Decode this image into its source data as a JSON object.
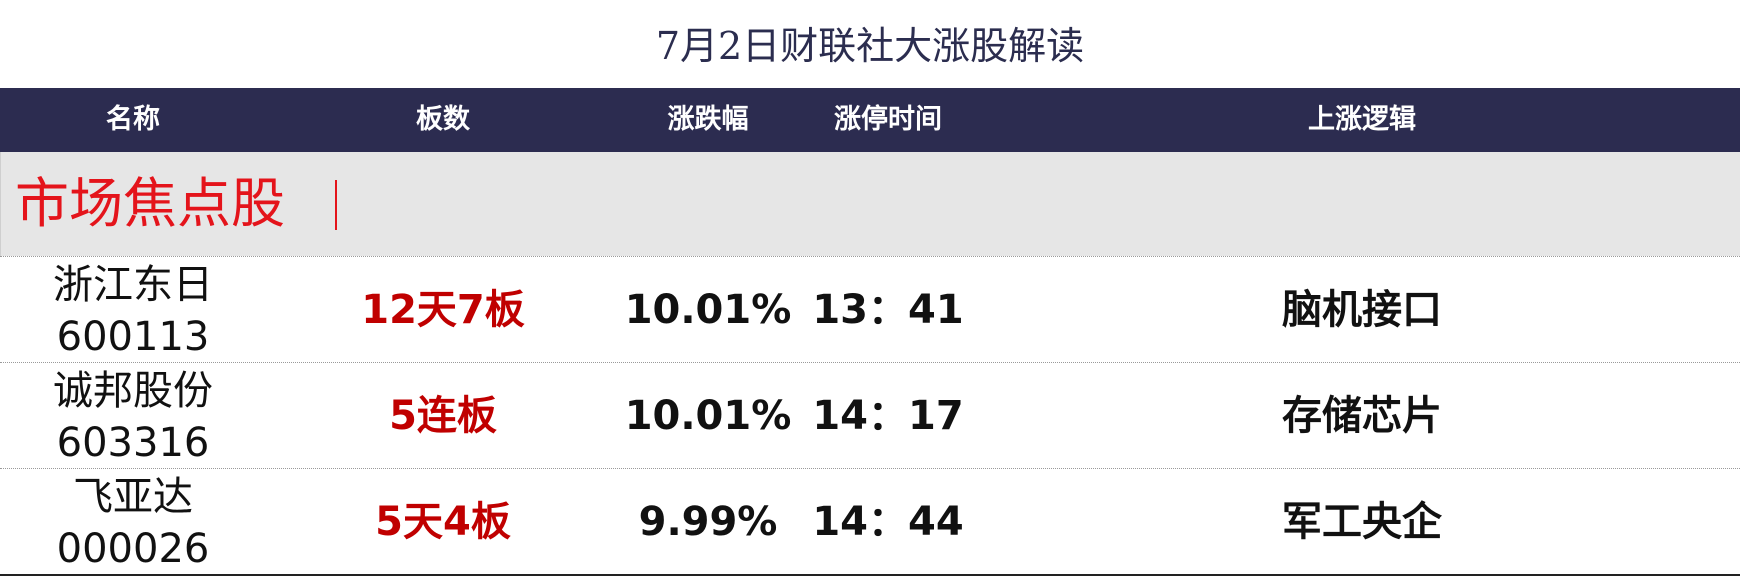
{
  "title": "7月2日财联社大涨股解读",
  "columns": [
    "名称",
    "板数",
    "涨跌幅",
    "涨停时间",
    "上涨逻辑"
  ],
  "section_label": "市场焦点股",
  "rows": [
    {
      "name": "浙江东日",
      "code": "600113",
      "boards": "12天7板",
      "change": "10.01%",
      "time": "13：41",
      "logic": "脑机接口"
    },
    {
      "name": "诚邦股份",
      "code": "603316",
      "boards": "5连板",
      "change": "10.01%",
      "time": "14：17",
      "logic": "存储芯片"
    },
    {
      "name": "飞亚达",
      "code": "000026",
      "boards": "5天4板",
      "change": "9.99%",
      "time": "14：44",
      "logic": "军工央企"
    }
  ],
  "colors": {
    "header_bg": "#2c2c50",
    "title_text": "#2b2d4f",
    "section_bg": "#e6e6e6",
    "section_text": "#e4141b",
    "boards_text": "#c00000"
  }
}
